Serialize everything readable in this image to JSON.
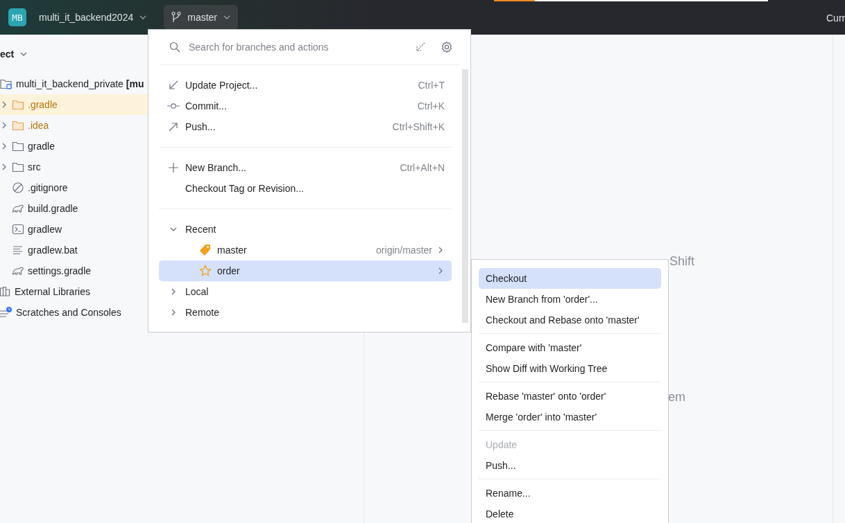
{
  "top_bar": {
    "project_badge": "MB",
    "project": "multi_it_backend2024",
    "branch": "master",
    "progress": {
      "level": 0.15
    },
    "right_label": "Curr"
  },
  "project_panel": {
    "title": "ect",
    "tree": [
      {
        "label": "multi_it_backend_private **[mu**",
        "kind": "module",
        "expanded": true,
        "children": [
          {
            "label": ".gradle",
            "kind": "folder",
            "ignored": true,
            "selected": true
          },
          {
            "label": ".idea",
            "kind": "folder",
            "ignored": true,
            "selected": false
          },
          {
            "label": "gradle",
            "kind": "folder",
            "ignored": false,
            "selected": false
          },
          {
            "label": "src",
            "kind": "folder",
            "ignored": false,
            "selected": false
          },
          {
            "label": ".gitignore",
            "kind": "gitignore",
            "ignored": false,
            "selected": false
          },
          {
            "label": "build.gradle",
            "kind": "gradle",
            "ignored": false,
            "selected": false
          },
          {
            "label": "gradlew",
            "kind": "terminal",
            "ignored": false,
            "selected": false
          },
          {
            "label": "gradlew.bat",
            "kind": "text",
            "ignored": false,
            "selected": false
          },
          {
            "label": "settings.gradle",
            "kind": "gradle",
            "ignored": false,
            "selected": false
          }
        ]
      },
      {
        "label": "External Libraries",
        "kind": "library",
        "expanded": false
      },
      {
        "label": "Scratches and Consoles",
        "kind": "scratches",
        "expanded": false
      }
    ]
  },
  "editor": {
    "hints": [
      "Shift",
      "em"
    ]
  },
  "branch_popup": {
    "search": {
      "placeholder": "Search for branches and actions"
    },
    "action_groups": [
      [
        {
          "kind": "update",
          "label": "Update Project...",
          "shortcut": "Ctrl+T"
        },
        {
          "kind": "commit",
          "label": "Commit...",
          "shortcut": "Ctrl+K"
        },
        {
          "kind": "push",
          "label": "Push...",
          "shortcut": "Ctrl+Shift+K"
        }
      ],
      [
        {
          "kind": "plus",
          "label": "New Branch...",
          "shortcut": "Ctrl+Alt+N"
        },
        {
          "kind": "plain",
          "label": "Checkout Tag or Revision..."
        }
      ]
    ],
    "branch_tree": [
      {
        "label": "Recent",
        "expanded": true,
        "children": [
          {
            "label": "master",
            "kind": "tag",
            "tracking": "origin/master",
            "selected": false
          },
          {
            "label": "order",
            "kind": "star",
            "selected": true
          }
        ]
      },
      {
        "label": "Local",
        "expanded": false
      },
      {
        "label": "Remote",
        "expanded": false
      }
    ]
  },
  "branch_submenu": {
    "groups": [
      [
        {
          "label": "Checkout",
          "selected": true,
          "disabled": false
        },
        {
          "label": "New Branch from 'order'...",
          "selected": false,
          "disabled": false
        },
        {
          "label": "Checkout and Rebase onto 'master'",
          "selected": false,
          "disabled": false
        }
      ],
      [
        {
          "label": "Compare with 'master'",
          "selected": false,
          "disabled": false
        },
        {
          "label": "Show Diff with Working Tree",
          "selected": false,
          "disabled": false
        }
      ],
      [
        {
          "label": "Rebase 'master' onto 'order'",
          "selected": false,
          "disabled": false
        },
        {
          "label": "Merge 'order' into 'master'",
          "selected": false,
          "disabled": false
        }
      ],
      [
        {
          "label": "Update",
          "selected": false,
          "disabled": true
        },
        {
          "label": "Push...",
          "selected": false,
          "disabled": false
        }
      ],
      [
        {
          "label": "Rename...",
          "selected": false,
          "disabled": false
        },
        {
          "label": "Delete",
          "selected": false,
          "disabled": false
        }
      ]
    ]
  }
}
